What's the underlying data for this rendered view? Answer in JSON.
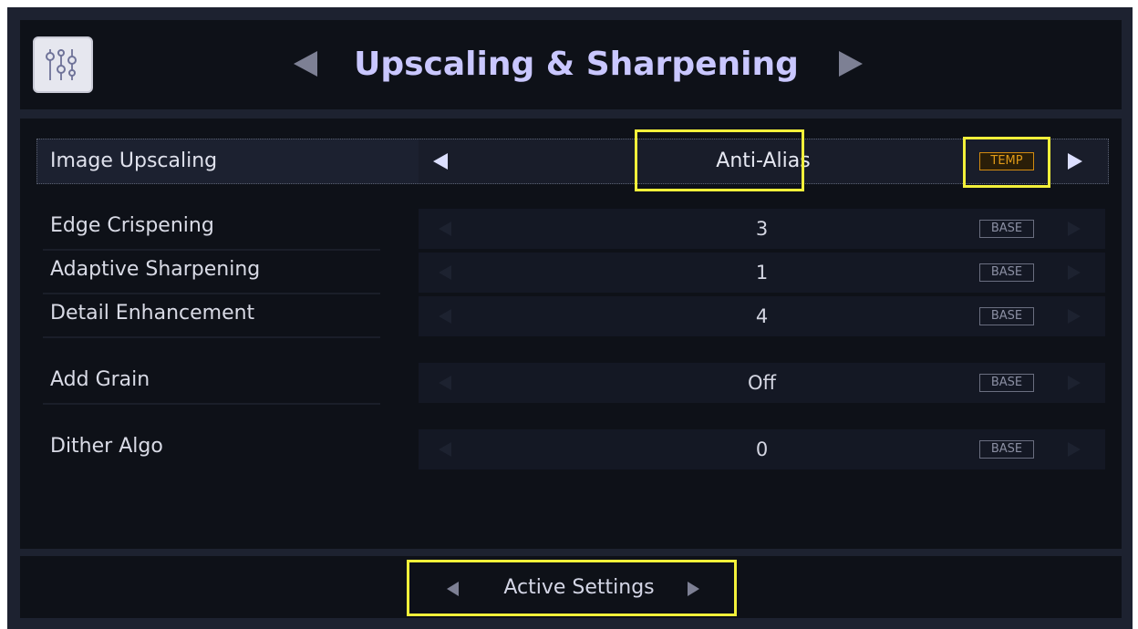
{
  "header": {
    "title": "Upscaling & Sharpening",
    "icon": "sliders-icon"
  },
  "selected_row": {
    "label": "Image Upscaling",
    "value": "Anti-Alias",
    "badge": "TEMP"
  },
  "rows": [
    {
      "label": "Edge Crispening",
      "value": "3",
      "badge": "BASE"
    },
    {
      "label": "Adaptive Sharpening",
      "value": "1",
      "badge": "BASE"
    },
    {
      "label": "Detail Enhancement",
      "value": "4",
      "badge": "BASE"
    },
    {
      "label": "Add Grain",
      "value": "Off",
      "badge": "BASE"
    },
    {
      "label": "Dither Algo",
      "value": "0",
      "badge": "BASE"
    }
  ],
  "footer": {
    "label": "Active Settings"
  },
  "colors": {
    "highlight": "#f2f03a",
    "title": "#c9c7ff",
    "temp_badge": "#e09a18"
  }
}
